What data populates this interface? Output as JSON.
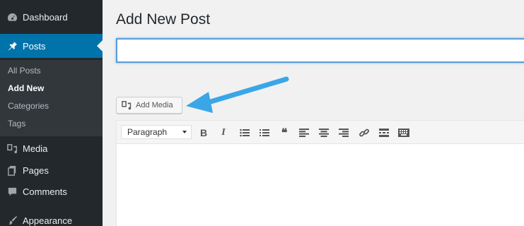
{
  "sidebar": {
    "items": [
      {
        "label": "Dashboard",
        "icon": "dashboard-icon"
      },
      {
        "label": "Posts",
        "icon": "pin-icon",
        "active": true
      },
      {
        "label": "Media",
        "icon": "media-icon"
      },
      {
        "label": "Pages",
        "icon": "pages-icon"
      },
      {
        "label": "Comments",
        "icon": "comments-icon"
      },
      {
        "label": "Appearance",
        "icon": "brush-icon"
      }
    ],
    "submenu": [
      {
        "label": "All Posts"
      },
      {
        "label": "Add New",
        "current": true
      },
      {
        "label": "Categories"
      },
      {
        "label": "Tags"
      }
    ]
  },
  "main": {
    "page_title": "Add New Post",
    "title_input": {
      "value": "",
      "placeholder": ""
    },
    "add_media_label": "Add Media",
    "toolbar": {
      "format": "Paragraph",
      "bold_label": "B",
      "italic_label": "I",
      "blockquote_label": "❝"
    }
  },
  "colors": {
    "sidebar_bg": "#23282d",
    "accent": "#0073aa",
    "annotation_arrow": "#3aa6e8"
  }
}
